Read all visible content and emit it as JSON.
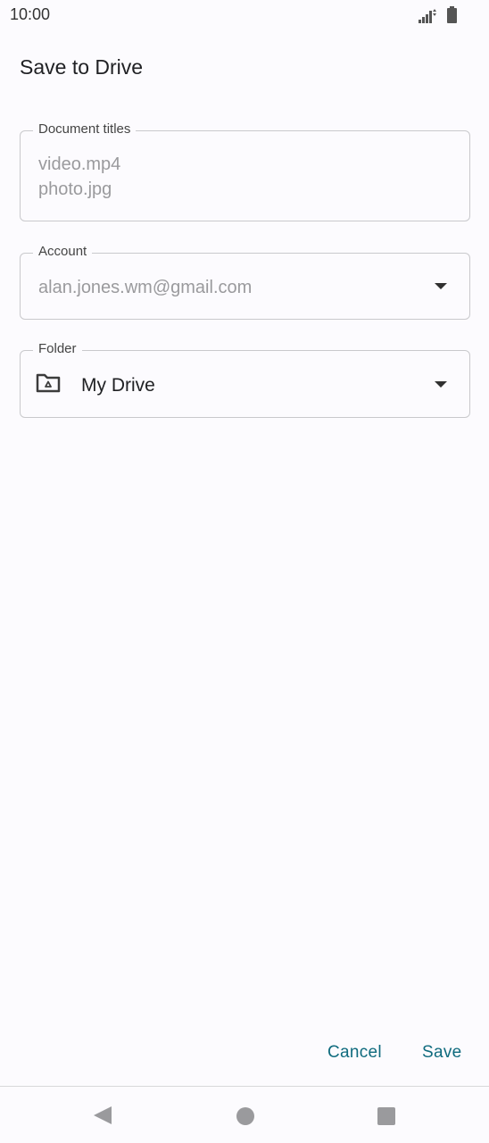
{
  "status_bar": {
    "time": "10:00",
    "icons": [
      "signal-icon",
      "battery-icon"
    ]
  },
  "dialog": {
    "title": "Save to Drive",
    "document_titles": {
      "label": "Document titles",
      "values": [
        "video.mp4",
        "photo.jpg"
      ]
    },
    "account": {
      "label": "Account",
      "value": "alan.jones.wm@gmail.com"
    },
    "folder": {
      "label": "Folder",
      "value": "My Drive",
      "icon": "drive-folder-icon"
    },
    "actions": {
      "cancel_label": "Cancel",
      "save_label": "Save"
    }
  },
  "nav_bar": {
    "icons": [
      "back-icon",
      "home-icon",
      "recents-icon"
    ]
  },
  "colors": {
    "background": "#fcfbfe",
    "accent": "#0f6b7e",
    "field_border": "#c9c9cc",
    "placeholder_text": "#9a9a9d"
  }
}
